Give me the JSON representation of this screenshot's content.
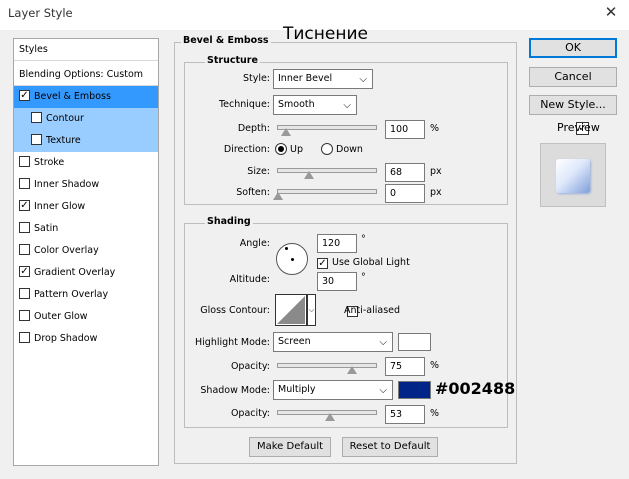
{
  "window": {
    "title": "Layer Style",
    "close_glyph": "✕"
  },
  "annotation_title": "Тиснение",
  "styles_panel": {
    "header": "Styles",
    "blending": "Blending Options: Custom",
    "items": [
      {
        "label": "Bevel & Emboss",
        "checked": true
      },
      {
        "label": "Contour",
        "checked": false
      },
      {
        "label": "Texture",
        "checked": false
      },
      {
        "label": "Stroke",
        "checked": false
      },
      {
        "label": "Inner Shadow",
        "checked": false
      },
      {
        "label": "Inner Glow",
        "checked": true
      },
      {
        "label": "Satin",
        "checked": false
      },
      {
        "label": "Color Overlay",
        "checked": false
      },
      {
        "label": "Gradient Overlay",
        "checked": true
      },
      {
        "label": "Pattern Overlay",
        "checked": false
      },
      {
        "label": "Outer Glow",
        "checked": false
      },
      {
        "label": "Drop Shadow",
        "checked": false
      }
    ]
  },
  "bevel": {
    "group_label": "Bevel & Emboss",
    "structure_label": "Structure",
    "style_label": "Style:",
    "style_value": "Inner Bevel",
    "technique_label": "Technique:",
    "technique_value": "Smooth",
    "depth_label": "Depth:",
    "depth_value": "100",
    "depth_unit": "%",
    "direction_label": "Direction:",
    "direction_up": "Up",
    "direction_down": "Down",
    "size_label": "Size:",
    "size_value": "68",
    "size_unit": "px",
    "soften_label": "Soften:",
    "soften_value": "0",
    "soften_unit": "px"
  },
  "shading": {
    "group_label": "Shading",
    "angle_label": "Angle:",
    "angle_value": "120",
    "angle_unit": "°",
    "global_light_label": "Use Global Light",
    "global_light_checked": true,
    "altitude_label": "Altitude:",
    "altitude_value": "30",
    "altitude_unit": "°",
    "gloss_label": "Gloss Contour:",
    "anti_aliased_label": "Anti-aliased",
    "highlight_mode_label": "Highlight Mode:",
    "highlight_mode_value": "Screen",
    "highlight_color": "#ffffff",
    "highlight_opacity_label": "Opacity:",
    "highlight_opacity_value": "75",
    "highlight_opacity_unit": "%",
    "shadow_mode_label": "Shadow Mode:",
    "shadow_mode_value": "Multiply",
    "shadow_color": "#002488",
    "shadow_color_annotation": "#002488",
    "shadow_opacity_label": "Opacity:",
    "shadow_opacity_value": "53",
    "shadow_opacity_unit": "%"
  },
  "buttons": {
    "make_default": "Make Default",
    "reset_default": "Reset to Default",
    "ok": "OK",
    "cancel": "Cancel",
    "new_style": "New Style...",
    "preview": "Preview"
  },
  "preview_checked": true,
  "dropdown_glyph": "⌵",
  "check_glyph": "✓"
}
